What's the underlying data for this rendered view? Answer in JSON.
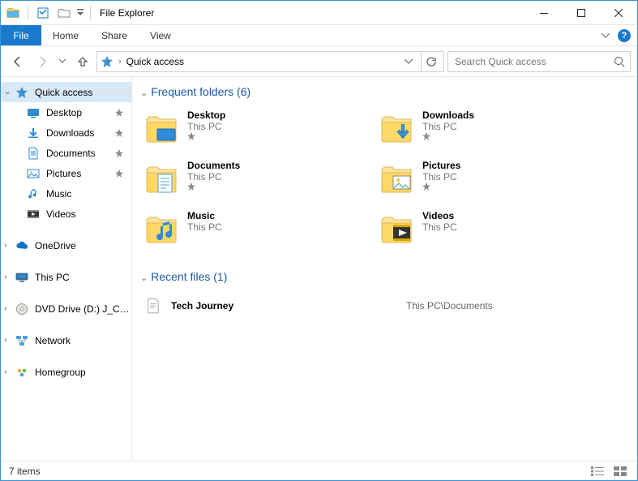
{
  "window": {
    "title": "File Explorer"
  },
  "ribbon": {
    "file": "File",
    "tabs": [
      "Home",
      "Share",
      "View"
    ]
  },
  "address": {
    "location": "Quick access"
  },
  "search": {
    "placeholder": "Search Quick access"
  },
  "nav": {
    "quick_access": "Quick access",
    "quick_items": [
      {
        "label": "Desktop",
        "icon": "desktop",
        "pinned": true
      },
      {
        "label": "Downloads",
        "icon": "download",
        "pinned": true
      },
      {
        "label": "Documents",
        "icon": "document",
        "pinned": true
      },
      {
        "label": "Pictures",
        "icon": "picture",
        "pinned": true
      },
      {
        "label": "Music",
        "icon": "music",
        "pinned": false
      },
      {
        "label": "Videos",
        "icon": "video",
        "pinned": false
      }
    ],
    "roots": [
      {
        "label": "OneDrive",
        "icon": "onedrive"
      },
      {
        "label": "This PC",
        "icon": "thispc"
      },
      {
        "label": "DVD Drive (D:) J_CPRA",
        "icon": "dvd"
      },
      {
        "label": "Network",
        "icon": "network"
      },
      {
        "label": "Homegroup",
        "icon": "homegroup"
      }
    ]
  },
  "frequent": {
    "title": "Frequent folders (6)",
    "items": [
      {
        "name": "Desktop",
        "location": "This PC",
        "icon": "desktop-folder",
        "pinned": true
      },
      {
        "name": "Downloads",
        "location": "This PC",
        "icon": "download-folder",
        "pinned": true
      },
      {
        "name": "Documents",
        "location": "This PC",
        "icon": "document-folder",
        "pinned": true
      },
      {
        "name": "Pictures",
        "location": "This PC",
        "icon": "picture-folder",
        "pinned": true
      },
      {
        "name": "Music",
        "location": "This PC",
        "icon": "music-folder",
        "pinned": false
      },
      {
        "name": "Videos",
        "location": "This PC",
        "icon": "video-folder",
        "pinned": false
      }
    ]
  },
  "recent": {
    "title": "Recent files (1)",
    "items": [
      {
        "name": "Tech Journey",
        "location": "This PC\\Documents",
        "icon": "file"
      }
    ]
  },
  "status": {
    "text": "7 items"
  }
}
